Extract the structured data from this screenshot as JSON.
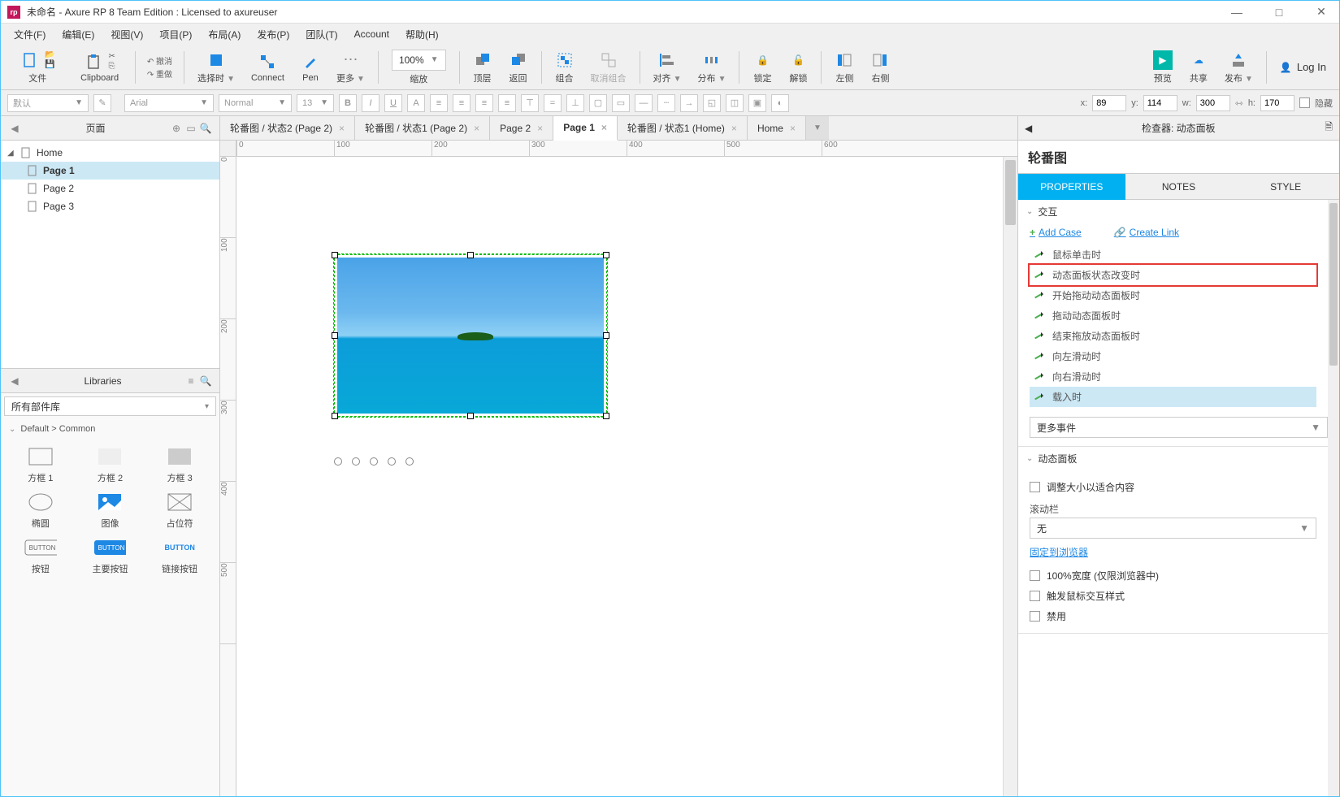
{
  "titlebar": {
    "title": "未命名 - Axure RP 8 Team Edition : Licensed to axureuser"
  },
  "menu": [
    "文件(F)",
    "编辑(E)",
    "视图(V)",
    "项目(P)",
    "布局(A)",
    "发布(P)",
    "团队(T)",
    "Account",
    "帮助(H)"
  ],
  "toolbar": {
    "file": "文件",
    "clipboard": "Clipboard",
    "undo": "撤消",
    "redo": "重做",
    "select_mode": "选择时",
    "connect": "Connect",
    "pen": "Pen",
    "more": "更多",
    "zoom": "100%",
    "zoom_label": "缩放",
    "front": "顶层",
    "back": "返回",
    "group": "组合",
    "ungroup": "取消组合",
    "align": "对齐",
    "distribute": "分布",
    "lock": "锁定",
    "unlock": "解锁",
    "left": "左侧",
    "right": "右侧",
    "preview": "预览",
    "share": "共享",
    "publish": "发布",
    "login": "Log In"
  },
  "fmtbar": {
    "style_preset": "默认",
    "font": "Arial",
    "variant": "Normal",
    "size": "13",
    "x_label": "x:",
    "x": "89",
    "y_label": "y:",
    "y": "114",
    "w_label": "w:",
    "w": "300",
    "h_label": "h:",
    "h": "170",
    "hidden": "隐藏"
  },
  "pages": {
    "title": "页面",
    "tree": [
      {
        "label": "Home",
        "children": [
          {
            "label": "Page 1",
            "selected": true
          },
          {
            "label": "Page 2"
          },
          {
            "label": "Page 3"
          }
        ]
      }
    ]
  },
  "libraries": {
    "title": "Libraries",
    "selector": "所有部件库",
    "category": "Default > Common",
    "items": [
      "方框 1",
      "方框 2",
      "方框 3",
      "椭圆",
      "图像",
      "占位符",
      "按钮",
      "主要按钮",
      "链接按钮"
    ]
  },
  "tabs": [
    {
      "label": "轮番图 / 状态2 (Page 2)"
    },
    {
      "label": "轮番图 / 状态1 (Page 2)"
    },
    {
      "label": "Page 2"
    },
    {
      "label": "Page 1",
      "active": true
    },
    {
      "label": "轮番图 / 状态1 (Home)"
    },
    {
      "label": "Home"
    }
  ],
  "ruler_h": [
    "0",
    "100",
    "200",
    "300",
    "400",
    "500",
    "600"
  ],
  "ruler_v": [
    "0",
    "100",
    "200",
    "300",
    "400",
    "500"
  ],
  "inspector": {
    "header": "检查器: 动态面板",
    "widget_name": "轮番图",
    "tabs": {
      "properties": "PROPERTIES",
      "notes": "NOTES",
      "style": "STYLE"
    },
    "section_interact": "交互",
    "add_case": "Add Case",
    "create_link": "Create Link",
    "events": [
      "鼠标单击时",
      "动态面板状态改变时",
      "开始拖动动态面板时",
      "拖动动态面板时",
      "结束拖放动态面板时",
      "向左滑动时",
      "向右滑动时",
      "载入时"
    ],
    "more_events": "更多事件",
    "section_dp": "动态面板",
    "fit_content": "调整大小以适合内容",
    "scrollbar_label": "滚动栏",
    "scrollbar_value": "无",
    "pin_browser": "固定到浏览器",
    "width_100": "100%宽度 (仅限浏览器中)",
    "trigger_mouse": "触发鼠标交互样式",
    "disabled": "禁用"
  }
}
